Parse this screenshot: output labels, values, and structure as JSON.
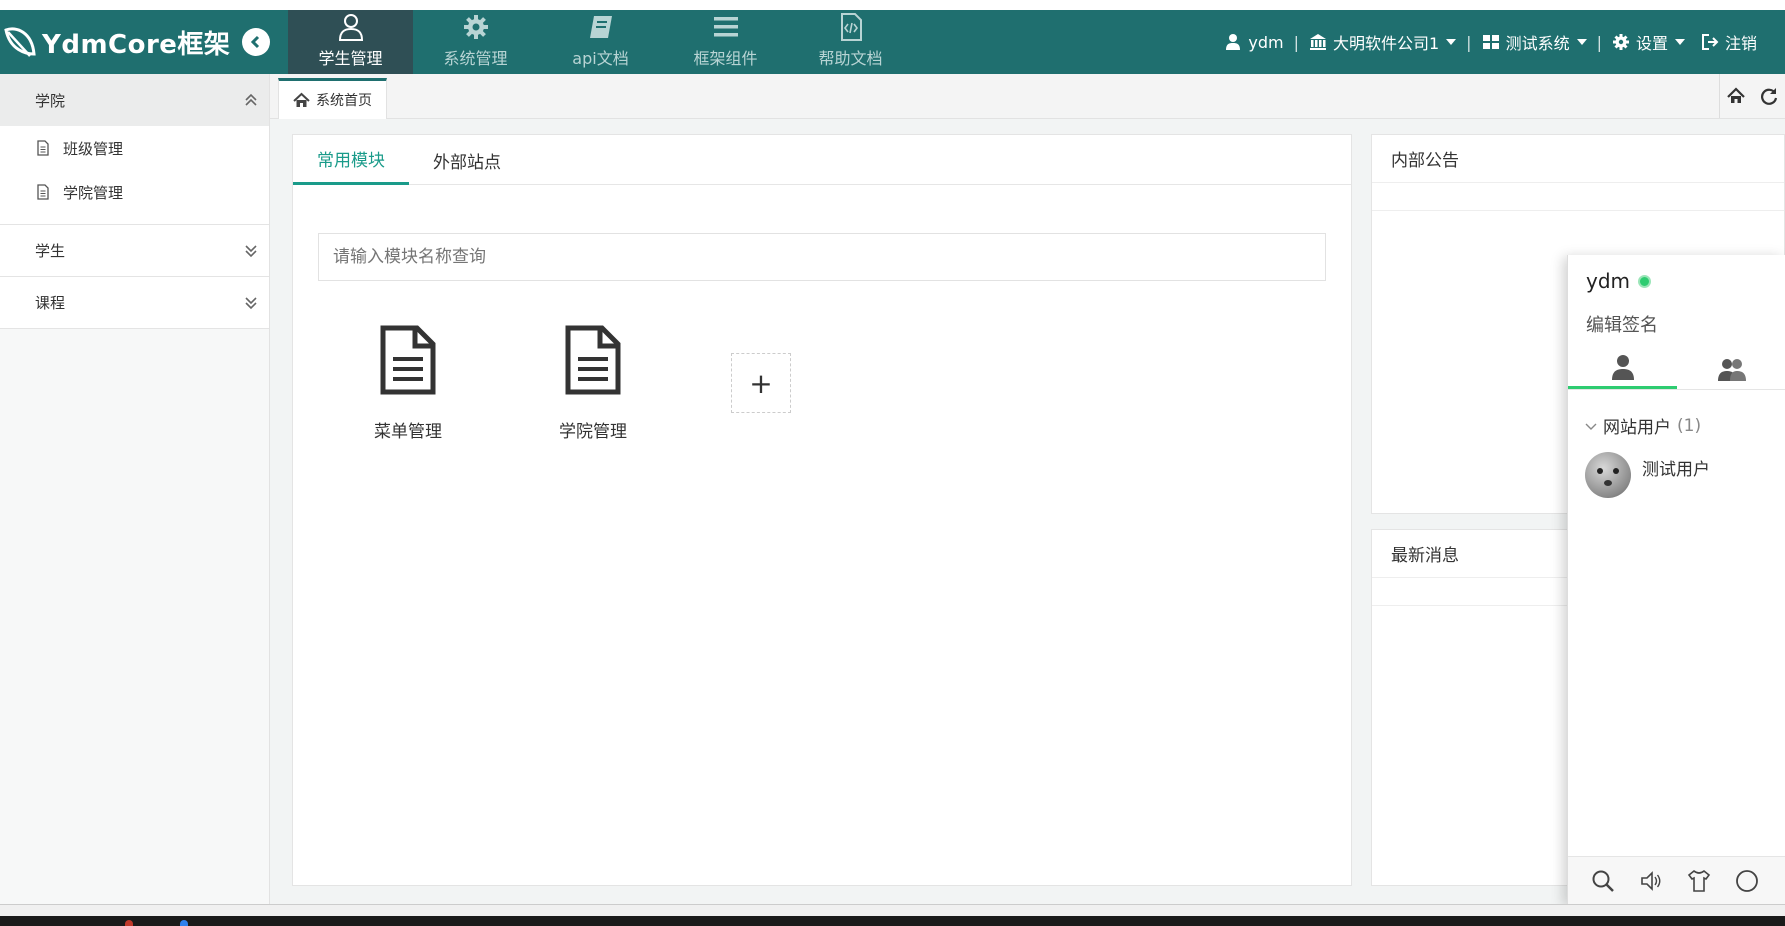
{
  "app": {
    "logo_text": "YdmCore框架"
  },
  "topnav": {
    "items": [
      {
        "label": "学生管理",
        "icon": "user-icon",
        "active": true
      },
      {
        "label": "系统管理",
        "icon": "gear-icon",
        "active": false
      },
      {
        "label": "api文档",
        "icon": "book-icon",
        "active": false
      },
      {
        "label": "框架组件",
        "icon": "bars-icon",
        "active": false
      },
      {
        "label": "帮助文档",
        "icon": "code-file-icon",
        "active": false
      }
    ]
  },
  "header_right": {
    "user": "ydm",
    "company": "大明软件公司1",
    "system": "测试系统",
    "settings": "设置",
    "logout": "注销"
  },
  "sidebar": {
    "groups": [
      {
        "label": "学院",
        "open": true,
        "items": [
          "班级管理",
          "学院管理"
        ]
      },
      {
        "label": "学生",
        "open": false,
        "items": []
      },
      {
        "label": "课程",
        "open": false,
        "items": []
      }
    ]
  },
  "tabbar": {
    "home_tab": "系统首页"
  },
  "main": {
    "tabs": [
      {
        "label": "常用模块",
        "active": true
      },
      {
        "label": "外部站点",
        "active": false
      }
    ],
    "search_placeholder": "请输入模块名称查询",
    "modules": [
      "菜单管理",
      "学院管理"
    ],
    "add_label": "+"
  },
  "right_panels": {
    "notice_title": "内部公告",
    "news_title": "最新消息"
  },
  "chat": {
    "name": "ydm",
    "signature": "编辑签名",
    "group_label": "网站用户",
    "group_count": "(1)",
    "users": [
      "测试用户"
    ],
    "status_color": "#2ecc71"
  },
  "colors": {
    "header_bg": "#1f6f6f",
    "active_nav_bg": "#2f4f55",
    "accent": "#1a9b8a"
  }
}
